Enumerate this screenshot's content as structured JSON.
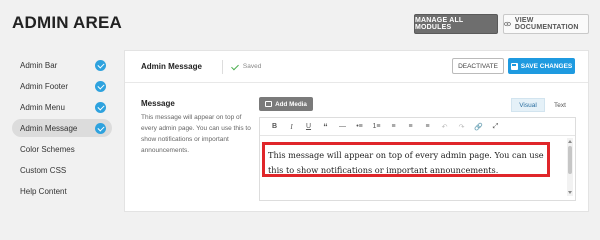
{
  "header": {
    "title": "ADMIN AREA",
    "manage_label": "MANAGE ALL MODULES",
    "docs_label": "VIEW DOCUMENTATION"
  },
  "sidebar": {
    "items": [
      {
        "label": "Admin Bar",
        "checked": true,
        "active": false
      },
      {
        "label": "Admin Footer",
        "checked": true,
        "active": false
      },
      {
        "label": "Admin Menu",
        "checked": true,
        "active": false
      },
      {
        "label": "Admin Message",
        "checked": true,
        "active": true
      },
      {
        "label": "Color Schemes",
        "checked": false,
        "active": false
      },
      {
        "label": "Custom CSS",
        "checked": false,
        "active": false
      },
      {
        "label": "Help Content",
        "checked": false,
        "active": false
      }
    ]
  },
  "panel": {
    "title": "Admin Message",
    "status": "Saved",
    "deactivate_label": "DEACTIVATE",
    "save_label": "SAVE CHANGES"
  },
  "field": {
    "label": "Message",
    "description": "This message will appear on top of every admin page. You can use this to show notifications or important announcements."
  },
  "editor": {
    "add_media_label": "Add Media",
    "tab_visual": "Visual",
    "tab_text": "Text",
    "toolbar": [
      "B",
      "I",
      "U",
      "“",
      "—",
      "•≡",
      "1≡",
      "≡",
      "≡",
      "≡",
      "↶",
      "↷",
      "🔗",
      "⤢"
    ],
    "content": "This message will appear on top of every admin page. You can use this to show notifications or important announcements."
  },
  "colors": {
    "accent": "#1e9ae0",
    "highlight": "#e0262a",
    "check": "#2ea2de"
  }
}
